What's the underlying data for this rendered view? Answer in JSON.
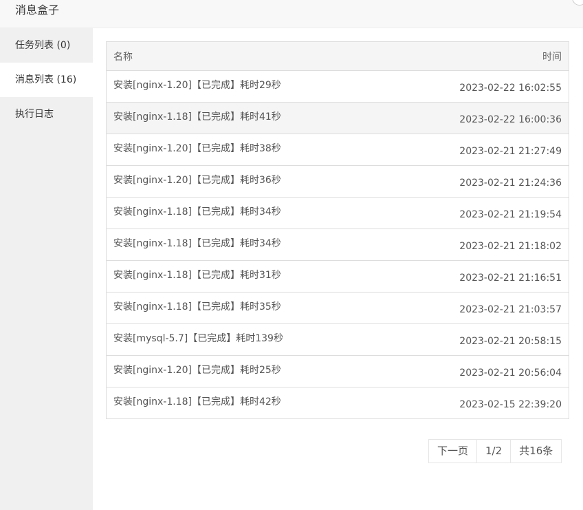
{
  "header": {
    "title": "消息盒子"
  },
  "sidebar": {
    "items": [
      {
        "label": "任务列表 (0)"
      },
      {
        "label": "消息列表 (16)"
      },
      {
        "label": "执行日志"
      }
    ]
  },
  "table": {
    "columns": {
      "name": "名称",
      "time": "时间"
    },
    "rows": [
      {
        "name": "安装[nginx-1.20]【已完成】耗时29秒",
        "time": "2023-02-22 16:02:55"
      },
      {
        "name": "安装[nginx-1.18]【已完成】耗时41秒",
        "time": "2023-02-22 16:00:36"
      },
      {
        "name": "安装[nginx-1.20]【已完成】耗时38秒",
        "time": "2023-02-21 21:27:49"
      },
      {
        "name": "安装[nginx-1.20]【已完成】耗时36秒",
        "time": "2023-02-21 21:24:36"
      },
      {
        "name": "安装[nginx-1.18]【已完成】耗时34秒",
        "time": "2023-02-21 21:19:54"
      },
      {
        "name": "安装[nginx-1.18]【已完成】耗时34秒",
        "time": "2023-02-21 21:18:02"
      },
      {
        "name": "安装[nginx-1.18]【已完成】耗时31秒",
        "time": "2023-02-21 21:16:51"
      },
      {
        "name": "安装[nginx-1.18]【已完成】耗时35秒",
        "time": "2023-02-21 21:03:57"
      },
      {
        "name": "安装[mysql-5.7]【已完成】耗时139秒",
        "time": "2023-02-21 20:58:15"
      },
      {
        "name": "安装[nginx-1.20]【已完成】耗时25秒",
        "time": "2023-02-21 20:56:04"
      },
      {
        "name": "安装[nginx-1.18]【已完成】耗时42秒",
        "time": "2023-02-15 22:39:20"
      }
    ]
  },
  "pager": {
    "next": "下一页",
    "page": "1/2",
    "total": "共16条"
  }
}
